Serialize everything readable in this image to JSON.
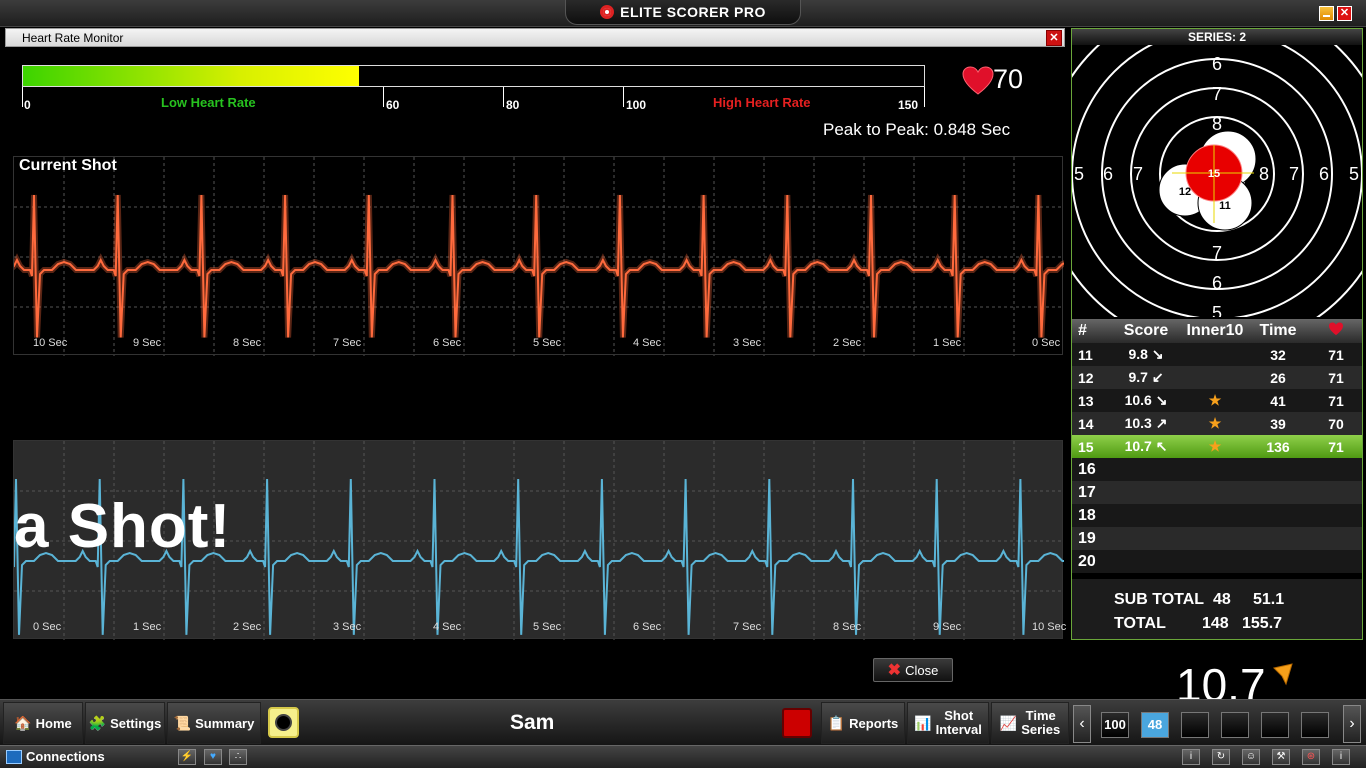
{
  "app": {
    "title": "ELITE SCORER PRO"
  },
  "hrm": {
    "title": "Heart Rate Monitor",
    "bar": {
      "value": 70,
      "min": 0,
      "max": 150,
      "low_label": "Low Heart Rate",
      "high_label": "High Heart Rate",
      "ticks": [
        "0",
        "60",
        "80",
        "100",
        "150"
      ]
    },
    "heart_rate": "70",
    "peak_to_peak": "Peak to Peak: 0.848 Sec",
    "current_shot_title": "Current Shot",
    "current_axis": [
      "10 Sec",
      "9 Sec",
      "8 Sec",
      "7 Sec",
      "6 Sec",
      "5 Sec",
      "4 Sec",
      "3 Sec",
      "2 Sec",
      "1 Sec",
      "0 Sec"
    ],
    "live_axis": [
      "0 Sec",
      "1 Sec",
      "2 Sec",
      "3 Sec",
      "4 Sec",
      "5 Sec",
      "6 Sec",
      "7 Sec",
      "8 Sec",
      "9 Sec",
      "10 Sec"
    ],
    "overlay_text": "a Shot!",
    "close_label": "Close",
    "colors": {
      "current": "#ff6a3d",
      "live": "#5ab4d6"
    }
  },
  "target": {
    "series_label": "SERIES: 2",
    "ring_labels_top": [
      "6",
      "7",
      "8"
    ],
    "ring_labels_bottom": [
      "7",
      "6",
      "5"
    ],
    "ring_labels_left": [
      "5",
      "6",
      "7"
    ],
    "ring_labels_right": [
      "8",
      "7",
      "6",
      "5"
    ],
    "shots": [
      "15",
      "12",
      "11"
    ]
  },
  "scores": {
    "headers": [
      "#",
      "Score",
      "Inner10",
      "Time"
    ],
    "rows": [
      {
        "num": "11",
        "score": "9.8",
        "dir": "↘",
        "star": "",
        "time": "32",
        "hr": "71"
      },
      {
        "num": "12",
        "score": "9.7",
        "dir": "↙",
        "star": "",
        "time": "26",
        "hr": "71"
      },
      {
        "num": "13",
        "score": "10.6",
        "dir": "↘",
        "star": "★",
        "time": "41",
        "hr": "71"
      },
      {
        "num": "14",
        "score": "10.3",
        "dir": "↗",
        "star": "★",
        "time": "39",
        "hr": "70"
      },
      {
        "num": "15",
        "score": "10.7",
        "dir": "↖",
        "star": "★",
        "time": "136",
        "hr": "71"
      }
    ],
    "empty": [
      "16",
      "17",
      "18",
      "19",
      "20"
    ],
    "subtotal_label": "SUB TOTAL",
    "subtotal_count": "48",
    "subtotal_score": "51.1",
    "total_label": "TOTAL",
    "total_count": "148",
    "total_score": "155.7"
  },
  "last_score": "10.7",
  "nav": {
    "home": "Home",
    "settings": "Settings",
    "summary": "Summary",
    "reports": "Reports",
    "shot_interval_1": "Shot",
    "shot_interval_2": "Interval",
    "time_series_1": "Time",
    "time_series_2": "Series"
  },
  "shooter": "Sam",
  "pages": [
    "100",
    "48",
    "",
    "",
    "",
    ""
  ],
  "status": {
    "connections": "Connections"
  }
}
